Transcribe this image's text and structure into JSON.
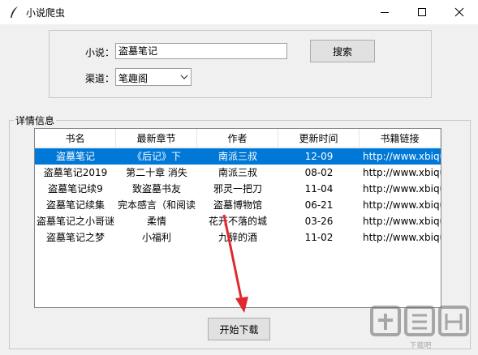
{
  "window": {
    "title": "小说爬虫"
  },
  "form": {
    "novel_label": "小说：",
    "novel_value": "盗墓笔记",
    "search_label": "搜索",
    "channel_label": "渠道：",
    "channel_value": "笔趣阁"
  },
  "details": {
    "title": "详情信息",
    "columns": [
      "书名",
      "最新章节",
      "作者",
      "更新时间",
      "书籍链接"
    ],
    "rows": [
      [
        "盗墓笔记",
        "《后记》下",
        "南派三叔",
        "12-09",
        "http://www.xbiqu"
      ],
      [
        "盗墓笔记2019",
        "第二十章 消失",
        "南派三叔",
        "08-02",
        "http://www.xbiqu"
      ],
      [
        "盗墓笔记续9",
        "致盗墓书友",
        "邪灵一把刀",
        "11-04",
        "http://www.xbiqu"
      ],
      [
        "盗墓笔记续集",
        "完本感言（和阅读",
        "盗墓博物馆",
        "06-21",
        "http://www.xbiqu"
      ],
      [
        "盗墓笔记之小哥谜",
        "柔情",
        "花开不落的城",
        "03-26",
        "http://www.xbiqu"
      ],
      [
        "盗墓笔记之梦",
        "小福利",
        "九辞的酒",
        "11-02",
        "http://www.xbiqu"
      ]
    ],
    "selected_row": 0
  },
  "download_label": "开始下载",
  "colors": {
    "selection": "#0078d7",
    "arrow": "#e0282e"
  },
  "watermark_text": "下载吧"
}
